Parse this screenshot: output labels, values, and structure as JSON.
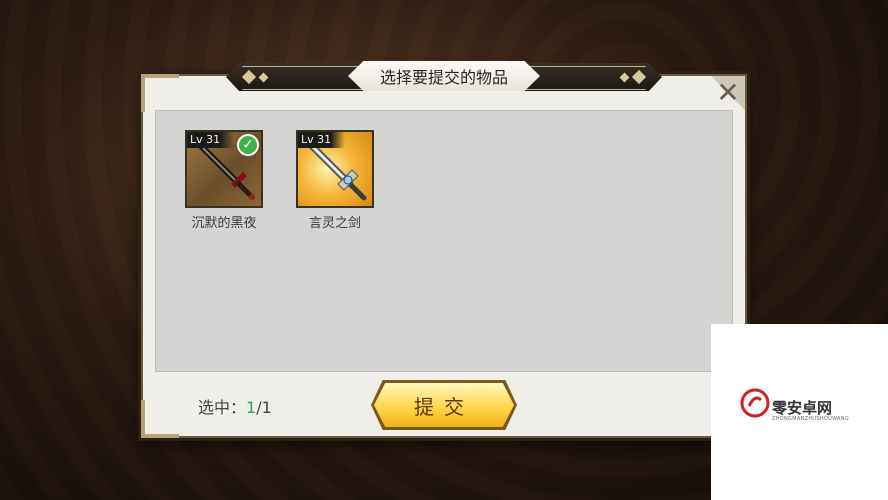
{
  "dialog": {
    "title": "选择要提交的物品",
    "close_icon": "close-x-icon"
  },
  "items": [
    {
      "level": "Lv 31",
      "name": "沉默的黑夜",
      "selected": true,
      "icon": "dark-sword-icon",
      "frame_color": "#8a6838"
    },
    {
      "level": "Lv 31",
      "name": "言灵之剑",
      "selected": false,
      "icon": "ornate-silver-sword-icon",
      "frame_color": "#f4b73a"
    }
  ],
  "footer": {
    "selected_prefix": "选中：",
    "selected_current": "1",
    "selected_total": "/1",
    "submit_label": "提交"
  },
  "watermark": {
    "brand": "零安卓网",
    "sub": "ZHONGMANZHUSHOUWANG"
  },
  "colors": {
    "accent_gold": "#ffd64d",
    "check_green": "#3fb34a",
    "selected_count": "#3a9d5a"
  }
}
